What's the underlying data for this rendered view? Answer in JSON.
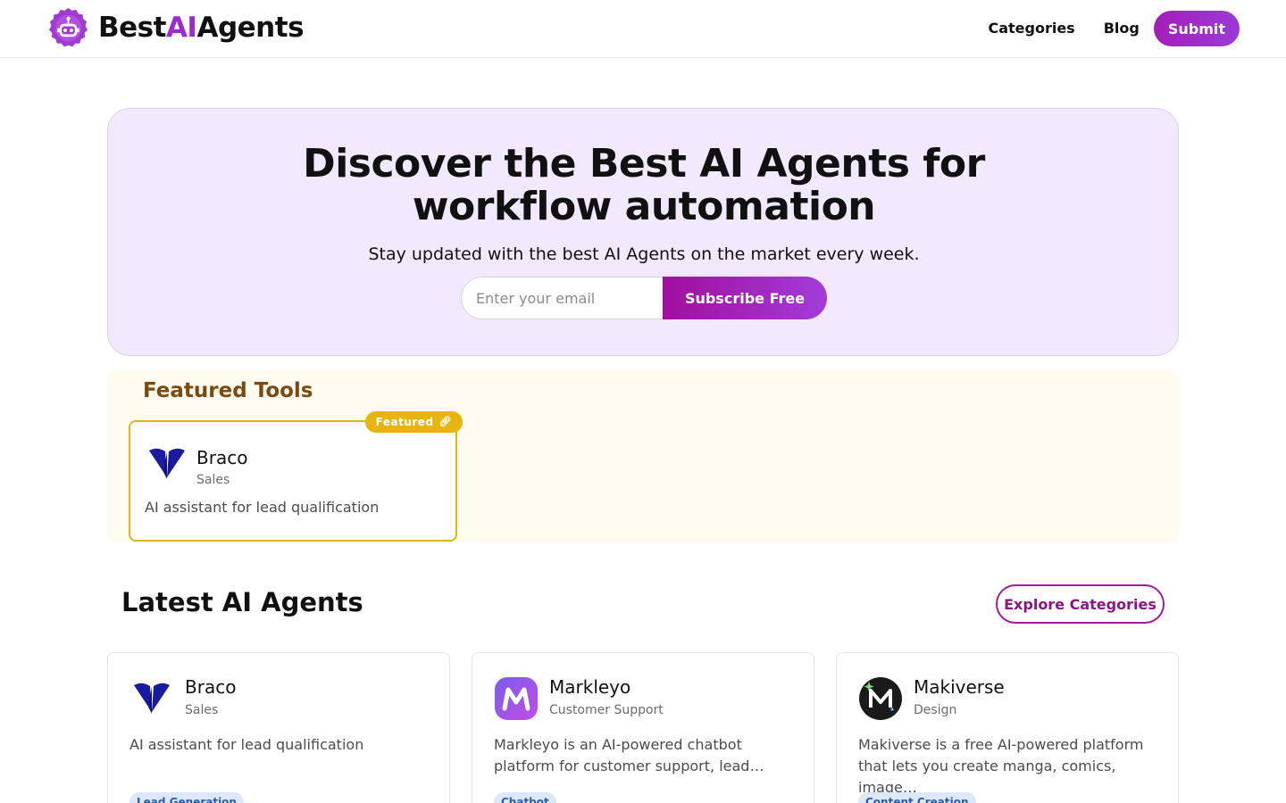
{
  "header": {
    "logo": {
      "part1": "Best",
      "part2": "AI",
      "part3": "Agents",
      "icon": "robot-icon"
    },
    "nav": {
      "categories": "Categories",
      "blog": "Blog",
      "submit": "Submit"
    }
  },
  "hero": {
    "title": "Discover the Best AI Agents for workflow automation",
    "subtitle": "Stay updated with the best AI Agents on the market every week.",
    "email_placeholder": "Enter your email",
    "subscribe_label": "Subscribe Free"
  },
  "featured": {
    "title": "Featured Tools",
    "badge": "Featured",
    "badge_icon": "link-icon",
    "card": {
      "name": "Braco",
      "category": "Sales",
      "description": "AI assistant for lead qualification",
      "icon": "braco-logo-icon"
    }
  },
  "latest": {
    "title": "Latest AI Agents",
    "explore_label": "Explore Categories",
    "cards": [
      {
        "name": "Braco",
        "category": "Sales",
        "description": "AI assistant for lead qualification",
        "tag": "Lead Generation",
        "icon": "braco-logo-icon"
      },
      {
        "name": "Markleyo",
        "category": "Customer Support",
        "description": "Markleyo is an AI-powered chatbot platform for customer support, lead…",
        "tag": "Chatbot",
        "icon": "markleyo-logo-icon"
      },
      {
        "name": "Makiverse",
        "category": "Design",
        "description": "Makiverse is a free AI-powered platform that lets you create manga, comics, image…",
        "tag": "Content Creation",
        "icon": "makiverse-logo-icon"
      }
    ]
  },
  "colors": {
    "brand_purple": "#9b2bd0",
    "hero_bg": "#f2e9fe",
    "featured_bg": "#fefcf0",
    "featured_gold": "#e3b512",
    "tag_bg": "#dbe8fb"
  }
}
